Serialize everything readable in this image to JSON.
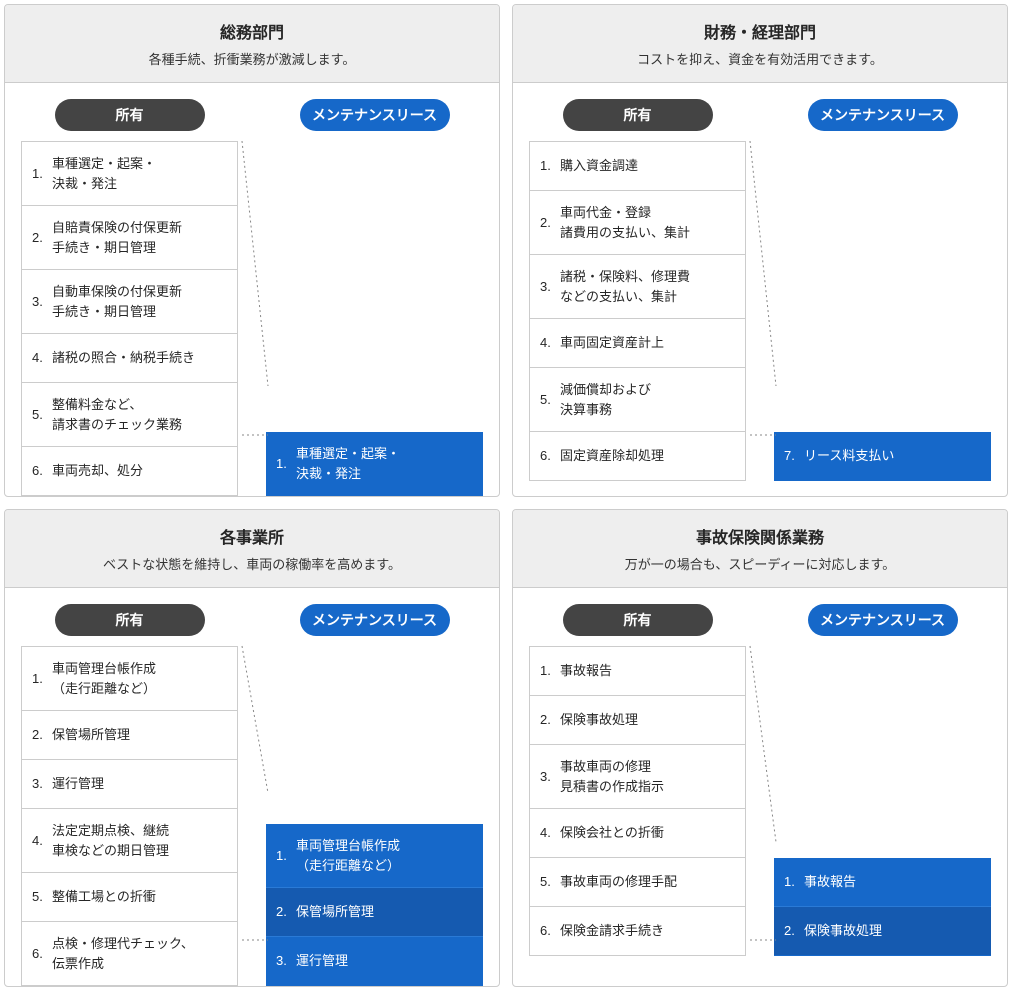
{
  "labels": {
    "own": "所有",
    "lease": "メンテナンスリース"
  },
  "cards": [
    {
      "title": "総務部門",
      "subtitle": "各種手続、折衝業務が激減します。",
      "own": [
        "車種選定・起案・\n決裁・発注",
        "自賠責保険の付保更新\n手続き・期日管理",
        "自動車保険の付保更新\n手続き・期日管理",
        "諸税の照合・納税手続き",
        "整備料金など、\n請求書のチェック業務",
        "車両売却、処分"
      ],
      "lease": [
        {
          "num": "1",
          "text": "車種選定・起案・\n決裁・発注"
        }
      ]
    },
    {
      "title": "財務・経理部門",
      "subtitle": "コストを抑え、資金を有効活用できます。",
      "own": [
        "購入資金調達",
        "車両代金・登録\n諸費用の支払い、集計",
        "諸税・保険料、修理費\nなどの支払い、集計",
        "車両固定資産計上",
        "減価償却および\n決算事務",
        "固定資産除却処理"
      ],
      "lease": [
        {
          "num": "7",
          "text": "リース料支払い"
        }
      ]
    },
    {
      "title": "各事業所",
      "subtitle": "ベストな状態を維持し、車両の稼働率を高めます。",
      "own": [
        "車両管理台帳作成\n（走行距離など）",
        "保管場所管理",
        "運行管理",
        "法定定期点検、継続\n車検などの期日管理",
        "整備工場との折衝",
        "点検・修理代チェック、\n伝票作成"
      ],
      "lease": [
        {
          "num": "1",
          "text": "車両管理台帳作成\n（走行距離など）"
        },
        {
          "num": "2",
          "text": "保管場所管理"
        },
        {
          "num": "3",
          "text": "運行管理"
        }
      ]
    },
    {
      "title": "事故保険関係業務",
      "subtitle": "万が一の場合も、スピーディーに対応します。",
      "own": [
        "事故報告",
        "保険事故処理",
        "事故車両の修理\n見積書の作成指示",
        "保険会社との折衝",
        "事故車両の修理手配",
        "保険金請求手続き"
      ],
      "lease": [
        {
          "num": "1",
          "text": "事故報告"
        },
        {
          "num": "2",
          "text": "保険事故処理"
        }
      ]
    }
  ]
}
